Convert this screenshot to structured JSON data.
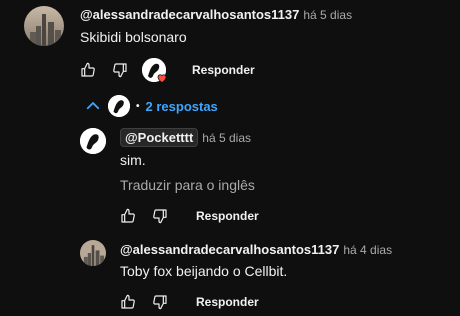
{
  "top_comment": {
    "author": "@alessandradecarvalhosantos1137",
    "time": "há 5 dias",
    "text": "Skibidi bolsonaro",
    "reply_label": "Responder"
  },
  "replies_toggle": {
    "label": "2 respostas",
    "separator": "•"
  },
  "reply_1": {
    "mention": "@Pocketttt",
    "time": "há 5 dias",
    "text": "sim.",
    "translate_label": "Traduzir para o inglês",
    "reply_label": "Responder"
  },
  "reply_2": {
    "author": "@alessandradecarvalhosantos1137",
    "time": "há 4 dias",
    "text": "Toby fox beijando o Cellbit.",
    "reply_label": "Responder"
  },
  "colors": {
    "background": "#0f0f0f",
    "link_blue": "#3ea6ff",
    "heart_red": "#ff4e45",
    "muted_text": "#aaaaaa"
  },
  "icons": [
    "thumbs-up-icon",
    "thumbs-down-icon",
    "heart-icon",
    "chevron-up-icon"
  ]
}
